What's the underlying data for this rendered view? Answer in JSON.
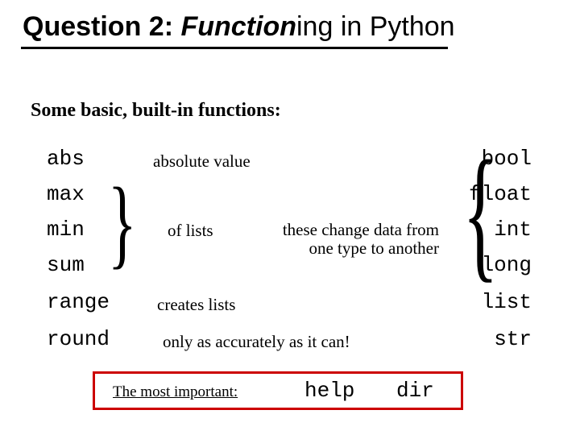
{
  "title": {
    "prefix": "Question 2: ",
    "italic": "Function",
    "suffix": "ing in Python"
  },
  "subtitle": "Some basic, built-in functions:",
  "left": {
    "abs": "abs",
    "max": "max",
    "min": "min",
    "sum": "sum",
    "range": "range",
    "round": "round"
  },
  "right": {
    "bool": "bool",
    "float": "float",
    "int": "int",
    "long": "long",
    "list": "list",
    "str": "str"
  },
  "desc": {
    "absval": "absolute value",
    "oflists": "of lists",
    "change1": "these change data from",
    "change2": "one type to another",
    "creates": "creates lists",
    "round": "only as accurately as it can!",
    "important": "The most important:"
  },
  "bottom": {
    "help": "help",
    "dir": "dir"
  }
}
